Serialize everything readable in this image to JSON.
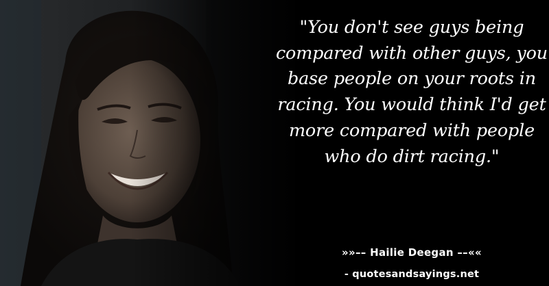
{
  "card": {
    "quote": "\"You don't see guys being compared with other guys, you base people on your roots in racing. You would think I'd get more compared with people who do dirt racing.\"",
    "author": "»»–– Hailie Deegan ––««",
    "website": "- quotesandsayings.net"
  },
  "colors": {
    "background": "#000000",
    "text": "#ffffff"
  }
}
